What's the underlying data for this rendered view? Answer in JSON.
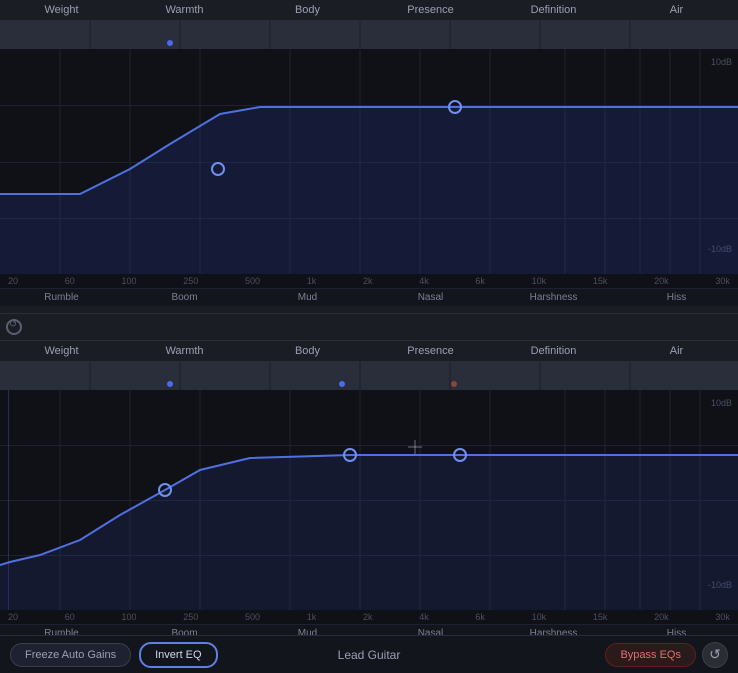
{
  "panel1": {
    "freq_labels": [
      "Weight",
      "Warmth",
      "Body",
      "Presence",
      "Definition",
      "Air"
    ],
    "db_top": "10dB",
    "db_bot": "-10dB",
    "freq_axis": [
      "20",
      "60",
      "100",
      "250",
      "500",
      "1k",
      "2k",
      "4k",
      "6k",
      "10k",
      "15k",
      "20k",
      "30k"
    ],
    "bottom_labels": [
      "Rumble",
      "Boom",
      "Mud",
      "Nasal",
      "Harshness",
      "Hiss"
    ]
  },
  "panel2": {
    "freq_labels": [
      "Weight",
      "Warmth",
      "Body",
      "Presence",
      "Definition",
      "Air"
    ],
    "db_top": "10dB",
    "db_bot": "-10dB",
    "freq_axis": [
      "20",
      "60",
      "100",
      "250",
      "500",
      "1k",
      "2k",
      "4k",
      "6k",
      "10k",
      "15k",
      "20k",
      "30k"
    ],
    "bottom_labels": [
      "Rumble",
      "Boom",
      "Mud",
      "Nasal",
      "Harshness",
      "Hiss"
    ]
  },
  "footer": {
    "freeze_label": "Freeze Auto Gains",
    "invert_label": "Invert EQ",
    "track_name": "Lead Guitar",
    "bypass_label": "Bypass EQs"
  }
}
